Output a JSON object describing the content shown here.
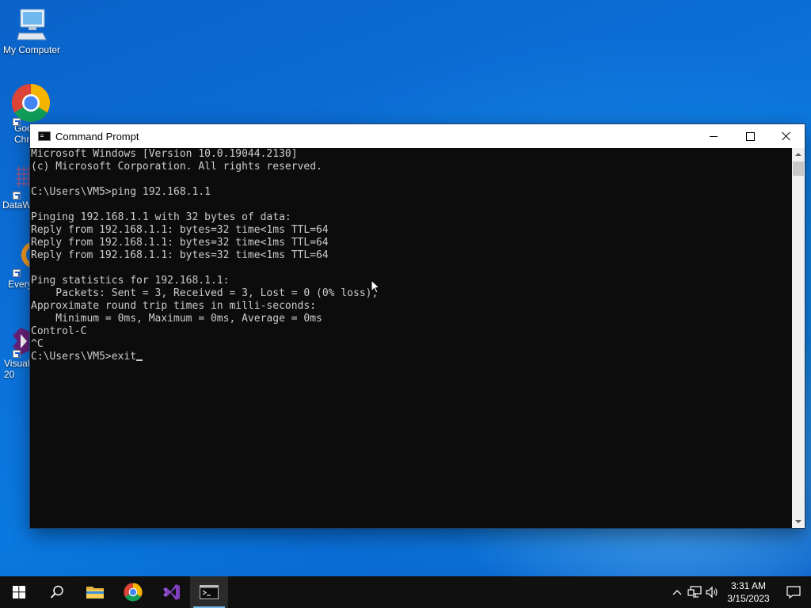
{
  "desktop": {
    "icons": [
      {
        "label": "My Computer"
      },
      {
        "label": "Goo\nChr"
      },
      {
        "label": "DataW"
      },
      {
        "label": "Every"
      },
      {
        "label": "Visual\n20"
      }
    ]
  },
  "window": {
    "title": "Command Prompt",
    "console_lines": [
      "Microsoft Windows [Version 10.0.19044.2130]",
      "(c) Microsoft Corporation. All rights reserved.",
      "",
      "C:\\Users\\VM5>ping 192.168.1.1",
      "",
      "Pinging 192.168.1.1 with 32 bytes of data:",
      "Reply from 192.168.1.1: bytes=32 time<1ms TTL=64",
      "Reply from 192.168.1.1: bytes=32 time<1ms TTL=64",
      "Reply from 192.168.1.1: bytes=32 time<1ms TTL=64",
      "",
      "Ping statistics for 192.168.1.1:",
      "    Packets: Sent = 3, Received = 3, Lost = 0 (0% loss),",
      "Approximate round trip times in milli-seconds:",
      "    Minimum = 0ms, Maximum = 0ms, Average = 0ms",
      "Control-C",
      "^C"
    ],
    "prompt_line": "C:\\Users\\VM5>exit"
  },
  "taskbar": {
    "clock_time": "3:31 AM",
    "clock_date": "3/15/2023"
  }
}
